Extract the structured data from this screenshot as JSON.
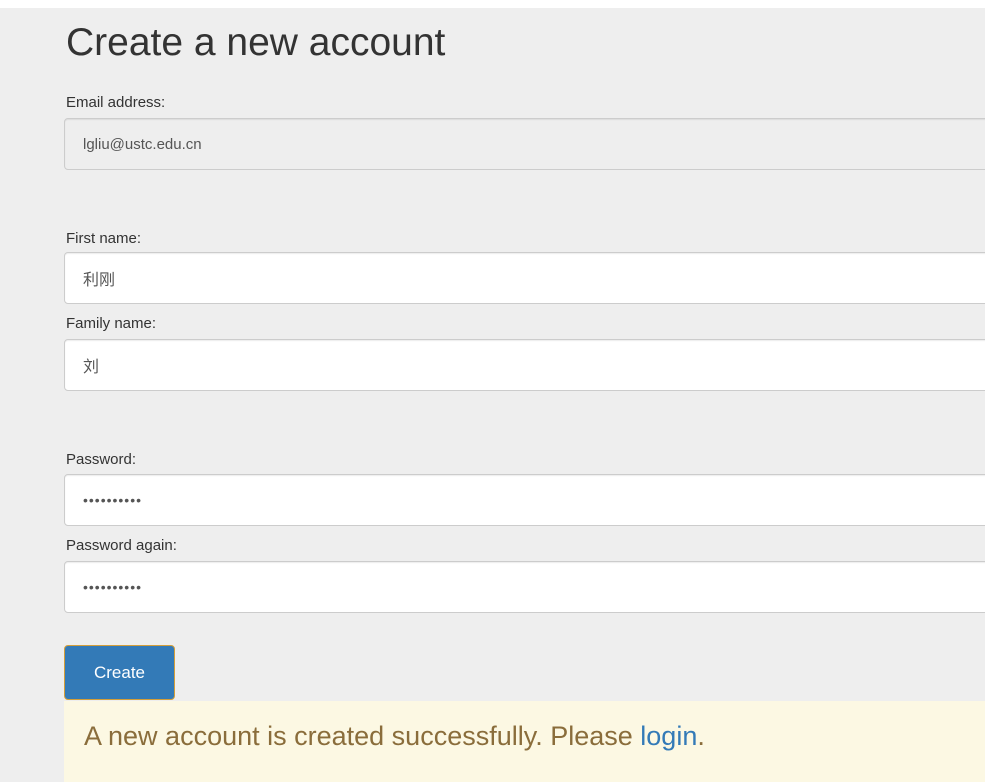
{
  "form": {
    "title": "Create a new account",
    "email": {
      "label": "Email address:",
      "value": "lgliu@ustc.edu.cn"
    },
    "first_name": {
      "label": "First name:",
      "value": "利刚"
    },
    "family_name": {
      "label": "Family name:",
      "value": "刘"
    },
    "password": {
      "label": "Password:",
      "value": "••••••••••"
    },
    "password_again": {
      "label": "Password again:",
      "value": "••••••••••"
    },
    "submit_label": "Create"
  },
  "alert": {
    "message": "A new account is created successfully. Please ",
    "link_label": "login",
    "suffix": "."
  }
}
